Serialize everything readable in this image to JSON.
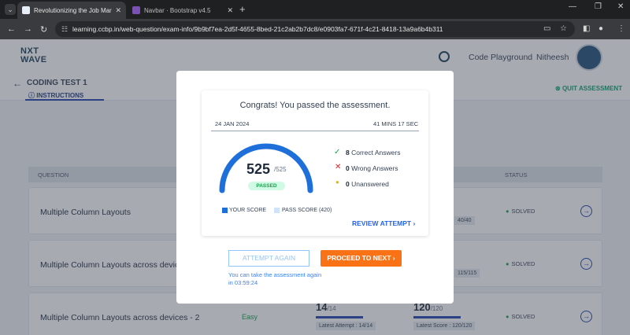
{
  "browser": {
    "tabs": [
      {
        "title": "Revolutionizing the Job Market",
        "close": "✕"
      },
      {
        "title": "Navbar · Bootstrap v4.5",
        "close": "✕"
      }
    ],
    "url": "learning.ccbp.in/web-question/exam-info/9b9bf7ea-2d5f-4655-8bed-21c2ab2b7dc8/e0903fa7-671f-4c21-8418-13a9a6b4b311"
  },
  "header": {
    "logo_line1": "NXT",
    "logo_line2": "WAVE",
    "code_playground": "Code Playground",
    "user_name": "Nitheesh"
  },
  "subheader": {
    "title": "CODING TEST 1",
    "instructions": "INSTRUCTIONS",
    "quit": "QUIT ASSESSMENT"
  },
  "table": {
    "col_question": "QUESTION",
    "col_status": "STATUS",
    "rows": [
      {
        "title": "Multiple Column Layouts",
        "status": "SOLVED",
        "latest_score": "40/40"
      },
      {
        "title": "Multiple Column Layouts across devices",
        "status": "SOLVED",
        "latest_score": "115/115"
      },
      {
        "title": "Multiple Column Layouts across devices - 2",
        "difficulty": "Easy",
        "attempt_score": "14",
        "attempt_total": "/14",
        "attempt_label": "Latest Attempt : 14/14",
        "score": "120",
        "score_total": "/120",
        "score_label": "Latest Score : 120/120",
        "status": "SOLVED"
      }
    ]
  },
  "modal": {
    "congrats": "Congrats! You passed the assessment.",
    "date": "24 JAN 2024",
    "time": "41 MINS 17 SEC",
    "score": "525",
    "score_total": "/525",
    "score_fraction": 1.0,
    "passed_badge": "PASSED",
    "legend_your": "YOUR SCORE",
    "legend_pass": "PASS SCORE (420)",
    "correct_count": "8",
    "correct_label": "Correct Answers",
    "wrong_count": "0",
    "wrong_label": "Wrong Answers",
    "unanswered_count": "0",
    "unanswered_label": "Unanswered",
    "review": "REVIEW ATTEMPT",
    "attempt_again": "ATTEMPT AGAIN",
    "proceed": "PROCEED TO NEXT",
    "again_note": "You can take the assessment again in 03:59:24"
  },
  "colors": {
    "accent_blue": "#1e6fd9",
    "pass_light": "#cfe3fb",
    "orange": "#f97316",
    "green": "#16a34a"
  }
}
